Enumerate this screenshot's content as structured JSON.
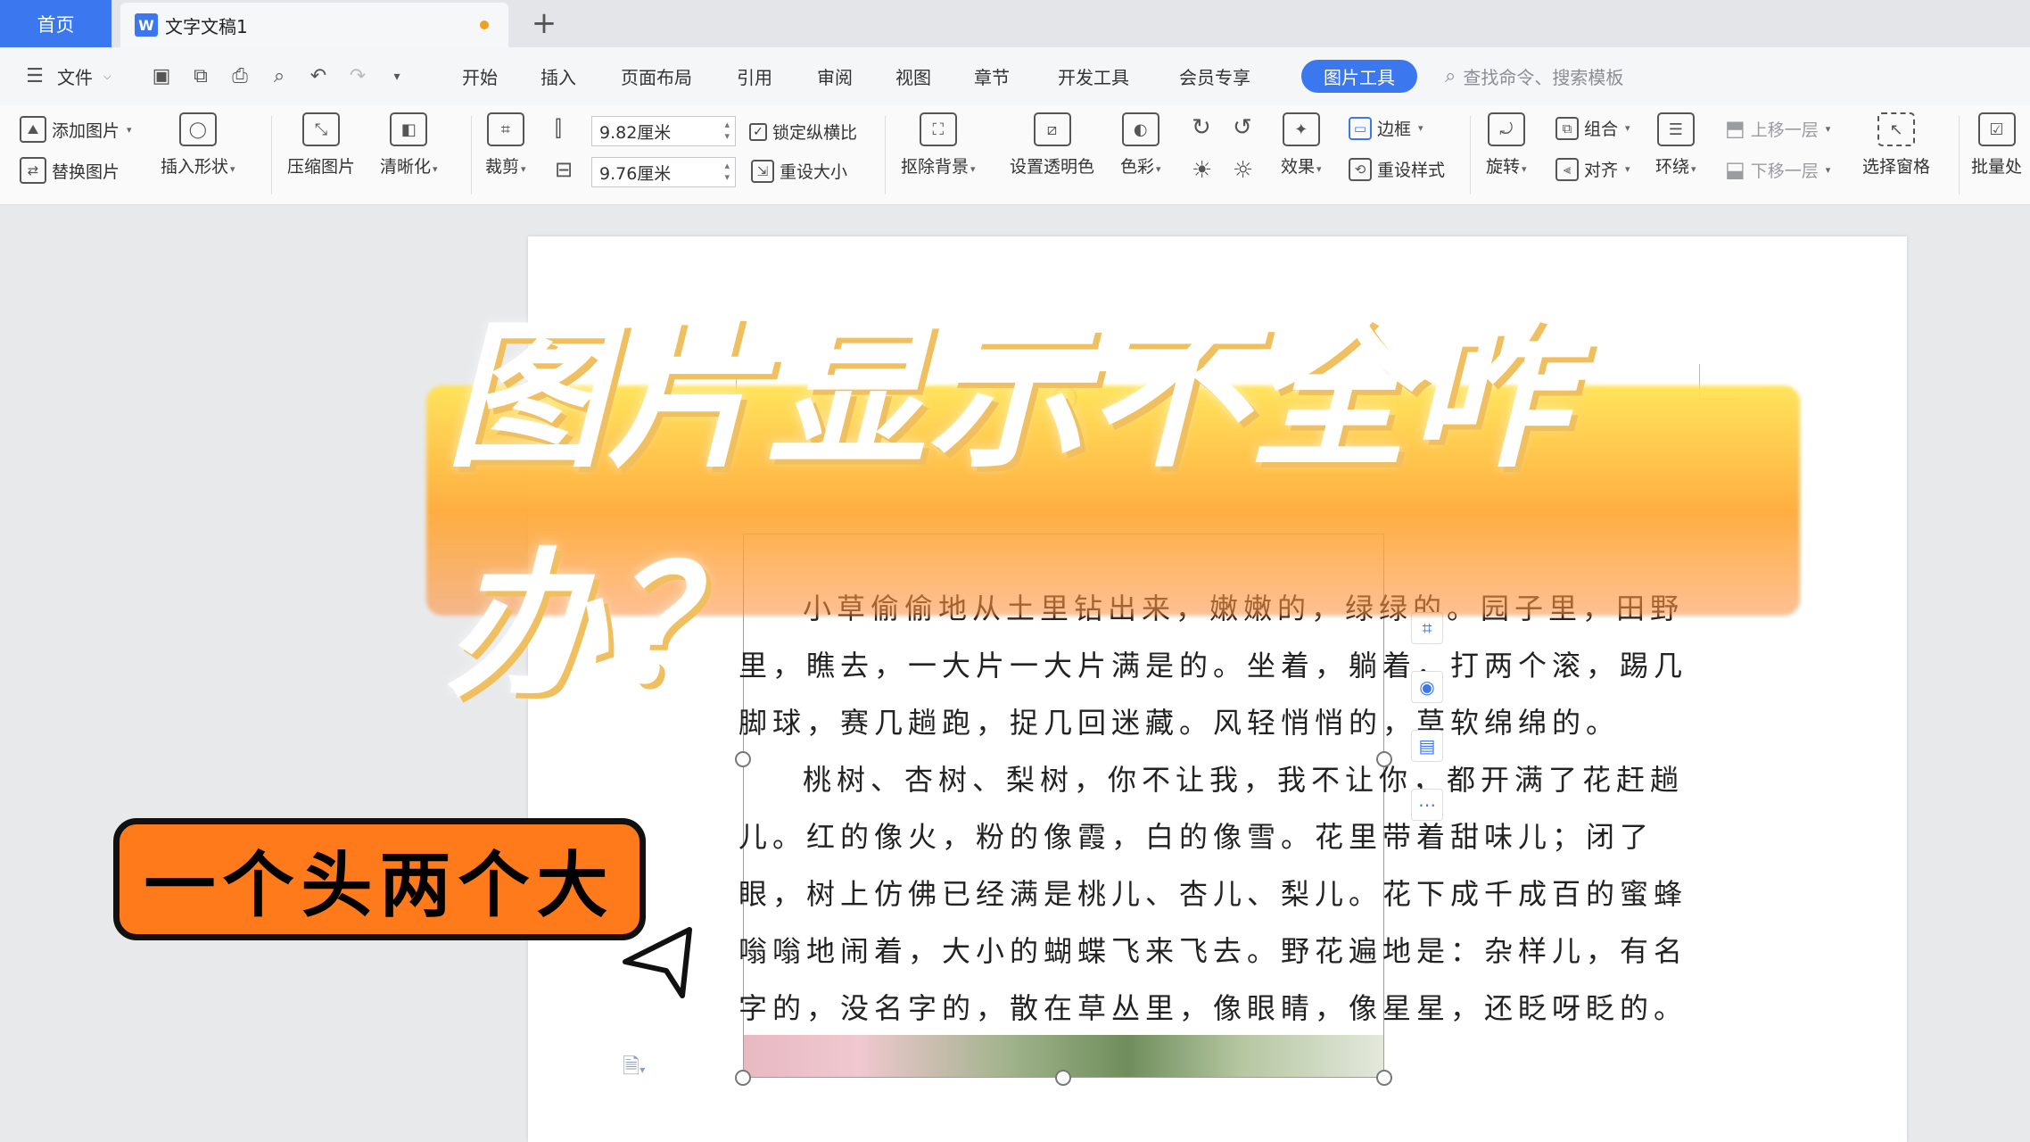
{
  "titlebar": {
    "home_tab": "首页",
    "doc_tab": "文字文稿1",
    "doc_icon": "W",
    "add_tab": "+"
  },
  "menubar": {
    "file": "文件",
    "items": [
      "开始",
      "插入",
      "页面布局",
      "引用",
      "审阅",
      "视图",
      "章节",
      "开发工具",
      "会员专享"
    ],
    "active": "图片工具",
    "search_placeholder": "查找命令、搜索模板"
  },
  "ribbon": {
    "add_picture": "添加图片",
    "replace_picture": "替换图片",
    "insert_shape": "插入形状",
    "compress_picture": "压缩图片",
    "sharpen": "清晰化",
    "crop": "裁剪",
    "height_value": "9.82厘米",
    "width_value": "9.76厘米",
    "lock_ratio": "锁定纵横比",
    "reset_size": "重设大小",
    "remove_background": "抠除背景",
    "set_transparent": "设置透明色",
    "color": "色彩",
    "effects": "效果",
    "border": "边框",
    "reset_style": "重设样式",
    "rotate": "旋转",
    "group": "组合",
    "align": "对齐",
    "wrap": "环绕",
    "bring_forward": "上移一层",
    "send_backward": "下移一层",
    "selection_pane": "选择窗格",
    "batch": "批量处"
  },
  "document": {
    "paragraphs": [
      "小草偷偷地从土里钻出来，嫩嫩的，绿绿的。园子里，田野里，瞧去，一大片一大片满是的。坐着，躺着，打两个滚，踢几脚球，赛几趟跑，捉几回迷藏。风轻悄悄的，草软绵绵的。",
      "桃树、杏树、梨树，你不让我，我不让你，都开满了花赶趟儿。红的像火，粉的像霞，白的像雪。花里带着甜味儿；闭了眼，树上仿佛已经满是桃儿、杏儿、梨儿。花下成千成百的蜜蜂嗡嗡地闹着，大小的蝴蝶飞来飞去。野花遍地是：杂样儿，有名字的，没名字的，散在草丛里，像眼睛，像星星，还眨呀眨的。"
    ]
  },
  "overlay": {
    "title": "图片显示不全咋办？",
    "badge": "一个头两个大"
  },
  "colors": {
    "accent": "#3b78f0",
    "badge_orange": "#ff7a1a",
    "banner_yellow": "#ffd23c"
  }
}
